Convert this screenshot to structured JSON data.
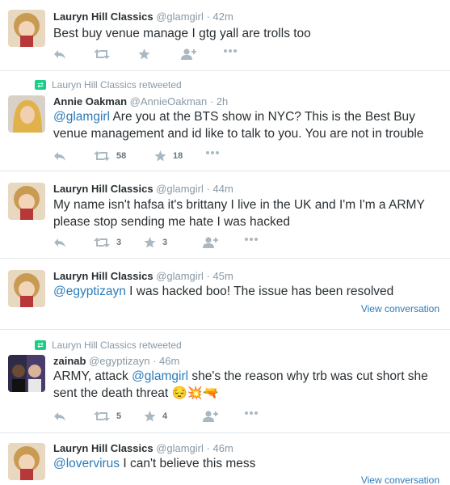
{
  "tweets": [
    {
      "retweeted_by": "",
      "name": "Lauryn Hill Classics",
      "handle": "@glamgirl",
      "time": "42m",
      "text_parts": [
        "Best buy venue manage I gtg yall are trolls too"
      ],
      "retweets": "",
      "likes": "",
      "view_conversation": ""
    },
    {
      "retweeted_by": "Lauryn Hill Classics retweeted",
      "name": "Annie Oakman",
      "handle": "@AnnieOakman",
      "time": "2h",
      "text_parts": [
        "@glamgirl",
        " Are you at the BTS show in NYC? This is the Best Buy venue management and id like to talk to you. You are not in trouble"
      ],
      "retweets": "58",
      "likes": "18",
      "view_conversation": ""
    },
    {
      "retweeted_by": "",
      "name": "Lauryn Hill Classics",
      "handle": "@glamgirl",
      "time": "44m",
      "text_parts": [
        "My name isn't hafsa it's brittany I live in the UK and I'm I'm a ARMY please stop sending me hate I was hacked"
      ],
      "retweets": "3",
      "likes": "3",
      "view_conversation": ""
    },
    {
      "retweeted_by": "",
      "name": "Lauryn Hill Classics",
      "handle": "@glamgirl",
      "time": "45m",
      "text_parts": [
        "@egyptizayn",
        " I was hacked boo! The issue has been resolved"
      ],
      "retweets": "",
      "likes": "",
      "view_conversation": "View conversation"
    },
    {
      "retweeted_by": "Lauryn Hill Classics retweeted",
      "name": "zainab",
      "handle": "@egyptizayn",
      "time": "46m",
      "text_parts": [
        "ARMY, attack ",
        "@glamgirl",
        " she's the reason why trb was cut short she sent the death threat 😔💥🔫"
      ],
      "retweets": "5",
      "likes": "4",
      "view_conversation": ""
    },
    {
      "retweeted_by": "",
      "name": "Lauryn Hill Classics",
      "handle": "@glamgirl",
      "time": "46m",
      "text_parts": [
        "@lovervirus",
        " I can't believe this mess"
      ],
      "retweets": "",
      "likes": "",
      "view_conversation": "View conversation"
    }
  ],
  "icons": {
    "reply": "reply-icon",
    "retweet": "retweet-icon",
    "like": "star-icon",
    "follow": "follow-user-icon",
    "more": "more-icon"
  },
  "colors": {
    "link": "#2b7bb9",
    "muted": "#8899a6",
    "retweet_badge": "#19cf86"
  }
}
